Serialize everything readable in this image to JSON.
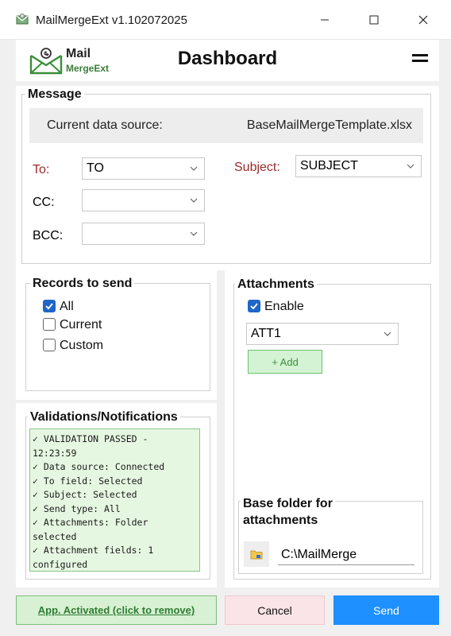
{
  "window": {
    "title": "MailMergeExt v1.102072025"
  },
  "header": {
    "logo_main": "Mail",
    "logo_sub": "MergeExt",
    "title": "Dashboard"
  },
  "message": {
    "group_label": "Message",
    "data_source_label": "Current data source:",
    "data_source_value": "BaseMailMergeTemplate.xlsx",
    "to_label": "To:",
    "to_value": "TO",
    "cc_label": "CC:",
    "cc_value": "",
    "bcc_label": "BCC:",
    "bcc_value": "",
    "subject_label": "Subject:",
    "subject_value": "SUBJECT"
  },
  "records": {
    "group_label": "Records to send",
    "options": [
      {
        "label": "All",
        "checked": true
      },
      {
        "label": "Current",
        "checked": false
      },
      {
        "label": "Custom",
        "checked": false
      }
    ]
  },
  "validations": {
    "group_label": "Validations/Notifications",
    "lines": [
      "✓ VALIDATION PASSED - 12:23:59",
      "✓ Data source: Connected",
      "✓ To field: Selected",
      "✓ Subject: Selected",
      "✓ Send type: All",
      "✓ Attachments: Folder selected",
      "✓ Attachment fields: 1 configured"
    ]
  },
  "attachments": {
    "group_label": "Attachments",
    "enable_label": "Enable",
    "enable_checked": true,
    "field_value": "ATT1",
    "add_label": "+ Add",
    "base_folder_label_line1": "Base folder for",
    "base_folder_label_line2": "attachments",
    "base_folder_value": "C:\\MailMerge"
  },
  "footer": {
    "activated_label": "App. Activated (click to remove)",
    "cancel_label": "Cancel",
    "send_label": "Send"
  },
  "colors": {
    "required_label": "#9b2a2a",
    "send_button": "#1e90ff",
    "checkbox_checked": "#1e66c8",
    "validation_bg": "#e6f7e1"
  },
  "icons": {
    "app": "app-icon",
    "logo": "mail-envelope-icon",
    "menu": "hamburger-menu-icon",
    "folder": "folder-icon"
  }
}
